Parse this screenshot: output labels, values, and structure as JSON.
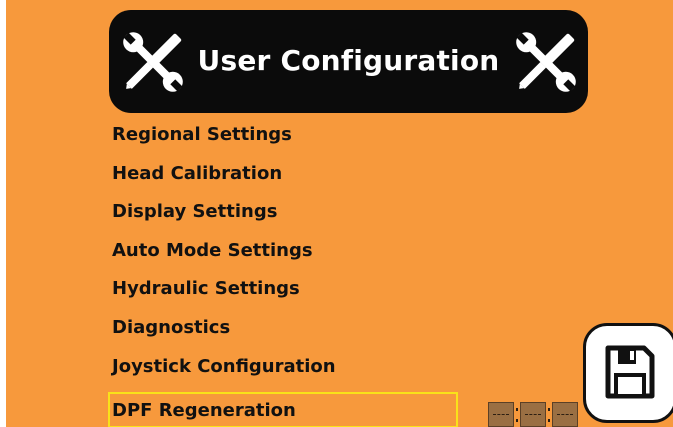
{
  "header": {
    "title": "User Configuration",
    "left_icon": "wrench-screwdriver-icon",
    "right_icon": "wrench-screwdriver-icon"
  },
  "menu": {
    "items": [
      {
        "label": "Regional Settings"
      },
      {
        "label": "Head Calibration"
      },
      {
        "label": "Display Settings"
      },
      {
        "label": "Auto Mode Settings"
      },
      {
        "label": "Hydraulic Settings"
      },
      {
        "label": "Diagnostics"
      },
      {
        "label": "Joystick Configuration"
      },
      {
        "label": "DPF Regeneration",
        "selected": true
      }
    ]
  },
  "save": {
    "icon": "save-icon"
  },
  "status_indicators": {
    "icon": "status-box-icon",
    "count": 3
  },
  "colors": {
    "background": "#f7993c",
    "header": "#0b0b0b",
    "selection": "#f9e21a",
    "text": "#111111"
  }
}
